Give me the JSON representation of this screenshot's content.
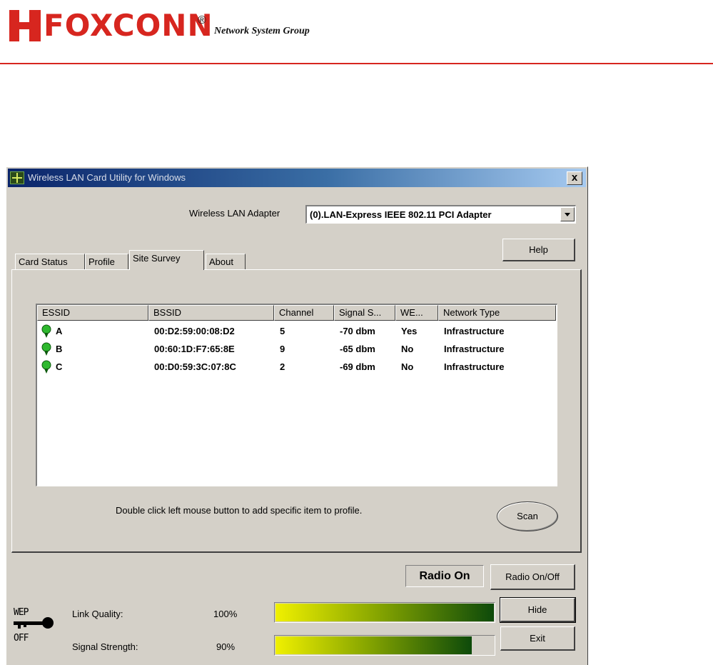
{
  "header": {
    "logo_text": "FOXCONN",
    "registered_mark": "®",
    "subtitle": "Network System Group"
  },
  "window": {
    "title": "Wireless LAN Card Utility for Windows",
    "close_label": "x"
  },
  "adapter": {
    "label": "Wireless LAN Adapter",
    "value": "(0).LAN-Express IEEE 802.11 PCI Adapter"
  },
  "help_label": "Help",
  "tabs": [
    {
      "label": "Card Status",
      "active": false
    },
    {
      "label": "Profile",
      "active": false
    },
    {
      "label": "Site Survey",
      "active": true
    },
    {
      "label": "About",
      "active": false
    }
  ],
  "site_survey": {
    "columns": [
      "ESSID",
      "BSSID",
      "Channel",
      "Signal S...",
      "WE...",
      "Network Type"
    ],
    "rows": [
      {
        "essid": "A",
        "bssid": "00:D2:59:00:08:D2",
        "channel": "5",
        "signal": "-70 dbm",
        "wep": "Yes",
        "network_type": "Infrastructure"
      },
      {
        "essid": "B",
        "bssid": "00:60:1D:F7:65:8E",
        "channel": "9",
        "signal": "-65 dbm",
        "wep": "No",
        "network_type": "Infrastructure"
      },
      {
        "essid": "C",
        "bssid": "00:D0:59:3C:07:8C",
        "channel": "2",
        "signal": "-69 dbm",
        "wep": "No",
        "network_type": "Infrastructure"
      }
    ],
    "hint": "Double click left mouse button to add specific item to profile.",
    "scan_label": "Scan",
    "row_icon": "green-signal-icon"
  },
  "radio": {
    "status": "Radio On",
    "toggle_label": "Radio On/Off"
  },
  "wep": {
    "top": "WEP",
    "bottom": "OFF",
    "icon": "key-icon"
  },
  "link_quality": {
    "label": "Link Quality:",
    "value": "100%",
    "fraction": 1.0
  },
  "signal_strength": {
    "label": "Signal Strength:",
    "value": "90%",
    "fraction": 0.9
  },
  "hide_label": "Hide",
  "exit_label": "Exit",
  "colors": {
    "brand": "#d7261f",
    "meter_start": "#f0f000",
    "meter_end": "#0d4a0a",
    "signal_icon": "#2eb82e"
  }
}
